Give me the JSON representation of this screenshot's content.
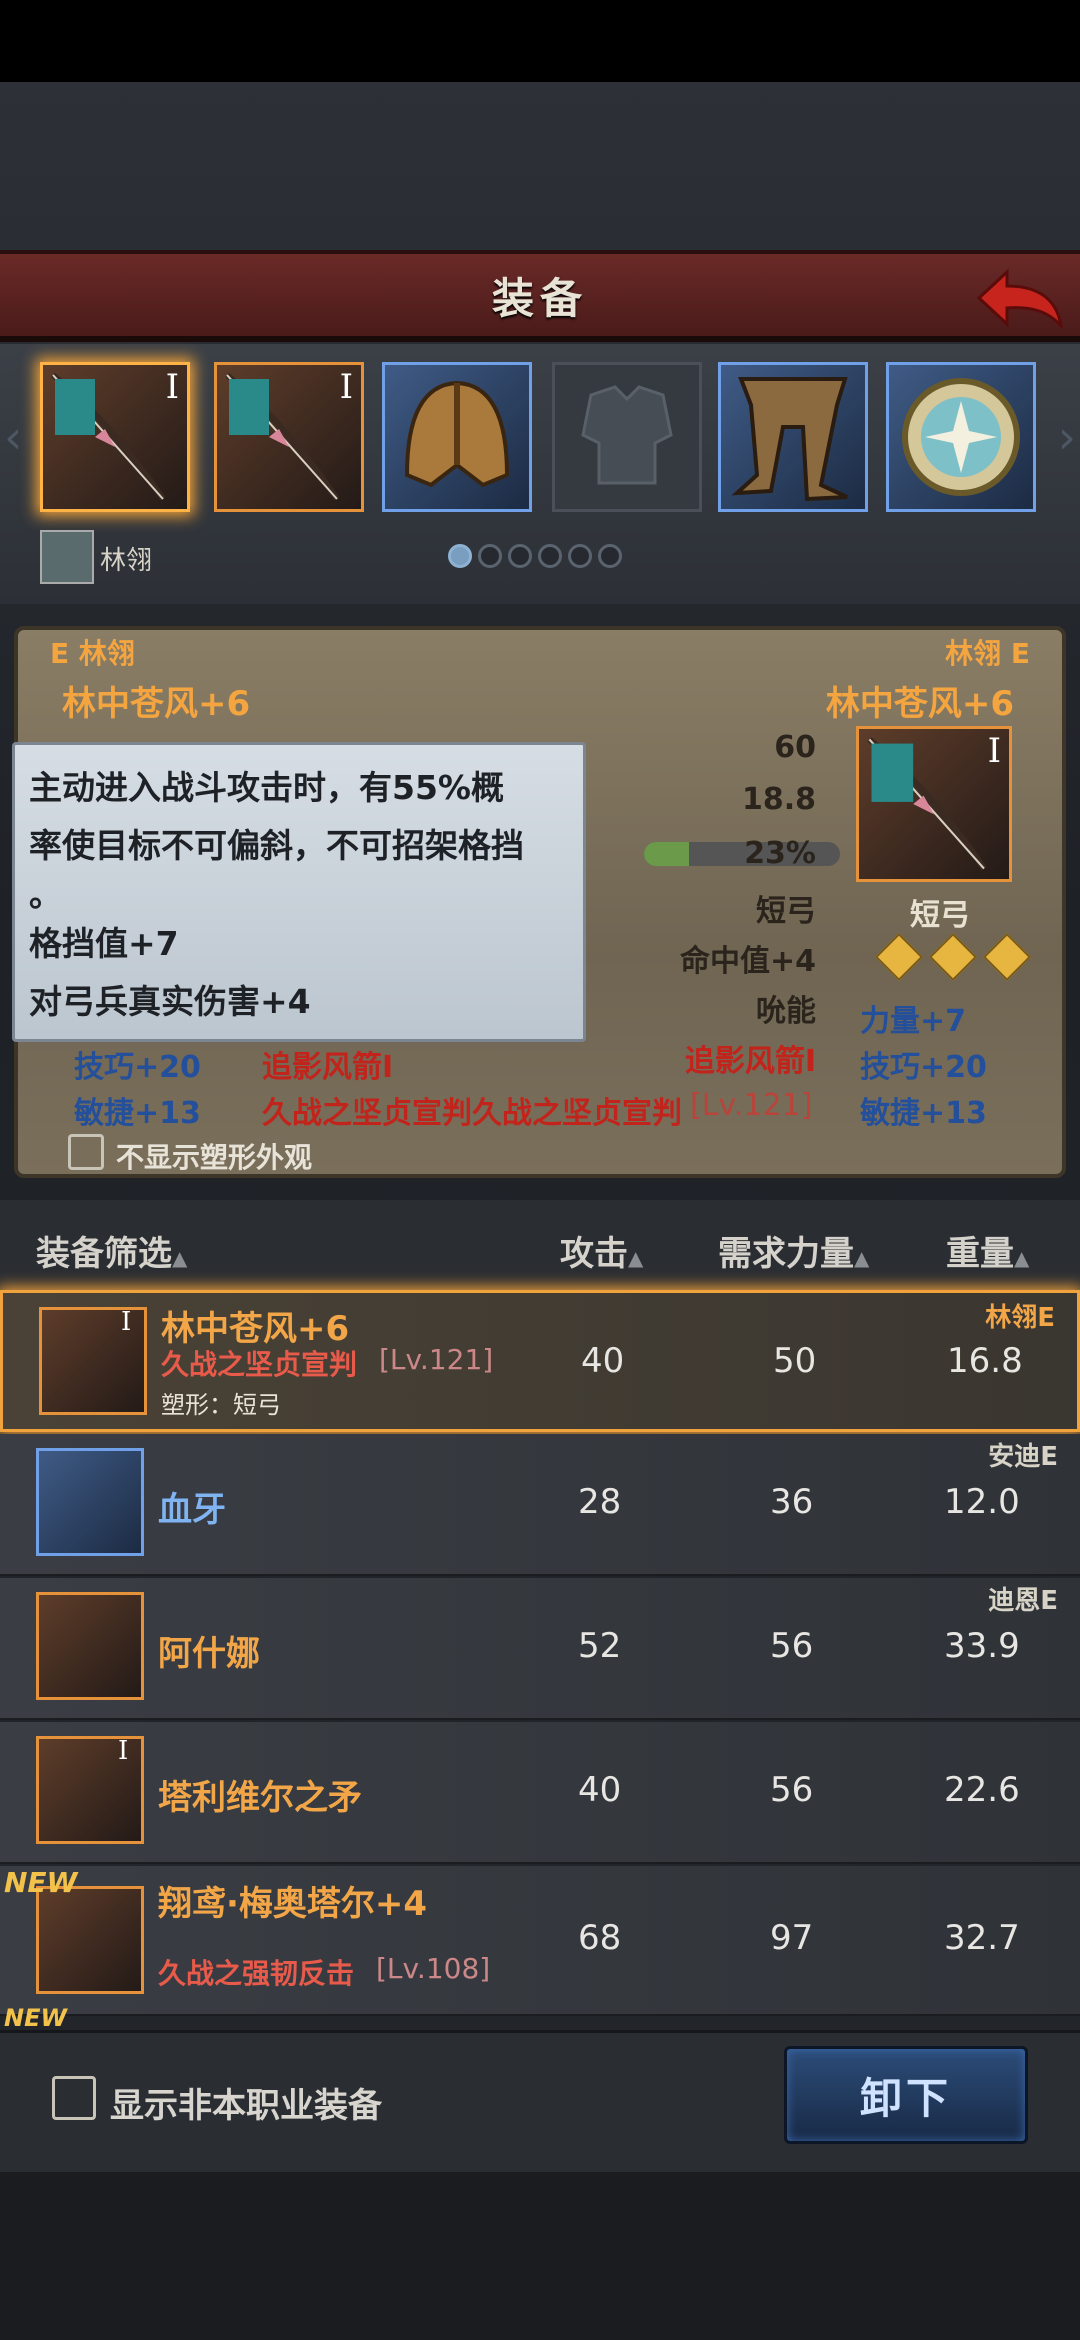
{
  "header": {
    "title": "装备"
  },
  "character": {
    "name": "林翎"
  },
  "slots": [
    {
      "icon": "bow-icon",
      "roman": "I",
      "color": "orange",
      "selected": true
    },
    {
      "icon": "bow-icon",
      "roman": "I",
      "color": "orange",
      "selected": false
    },
    {
      "icon": "helmet-icon",
      "roman": "",
      "color": "blue",
      "selected": false
    },
    {
      "icon": "armor-icon",
      "roman": "",
      "color": "empty",
      "selected": false
    },
    {
      "icon": "boots-icon",
      "roman": "",
      "color": "blue",
      "selected": false
    },
    {
      "icon": "amulet-icon",
      "roman": "",
      "color": "blue",
      "selected": false
    }
  ],
  "compare": {
    "left_owner": "E 林翎",
    "right_owner": "林翎 E",
    "left_item": "林中苍风+6",
    "right_item": "林中苍风+6",
    "right_icon_roman": "I",
    "right_stats": {
      "strength_req": "60",
      "weight": "18.8",
      "percent": "23%",
      "type": "短弓",
      "hit": "命中值+4",
      "skill": "吮能",
      "arrow": "追影风箭I"
    },
    "right_type_label": "短弓",
    "right_attrs": [
      "力量+7",
      "技巧+20",
      "敏捷+13"
    ],
    "left_attrs": [
      "技巧+20",
      "敏捷+13"
    ],
    "left_arrow": "追影风箭I",
    "set_effect": "久战之坚贞宣判久战之坚贞宣判",
    "set_level": "[Lv.121]",
    "hide_appearance": "不显示塑形外观"
  },
  "tooltip": {
    "line1": "主动进入战斗攻击时，有55%概",
    "line2": "率使目标不可偏斜，不可招架格挡",
    "line3": "。",
    "line4": "格挡值+7",
    "line5": "对弓兵真实伤害+4"
  },
  "list_header": {
    "filter": "装备筛选",
    "attack": "攻击",
    "str_req": "需求力量",
    "weight": "重量"
  },
  "items": [
    {
      "name": "林中苍风+6",
      "sub": "久战之坚贞宣判",
      "lv": "[Lv.121]",
      "shape": "塑形：短弓",
      "attack": "40",
      "str": "50",
      "weight": "16.8",
      "owner": "林翎E",
      "roman": "I"
    },
    {
      "name": "血牙",
      "attack": "28",
      "str": "36",
      "weight": "12.0",
      "owner": "安迪E"
    },
    {
      "name": "阿什娜",
      "attack": "52",
      "str": "56",
      "weight": "33.9",
      "owner": "迪恩E"
    },
    {
      "name": "塔利维尔之矛",
      "attack": "40",
      "str": "56",
      "weight": "22.6",
      "roman": "I"
    },
    {
      "name": "翔鸢·梅奥塔尔+4",
      "sub": "久战之强韧反击",
      "lv": "[Lv.108]",
      "attack": "68",
      "str": "97",
      "weight": "32.7",
      "new": "NEW"
    }
  ],
  "next_new": "NEW",
  "bottom": {
    "show_other": "显示非本职业装备",
    "unequip": "卸下"
  }
}
